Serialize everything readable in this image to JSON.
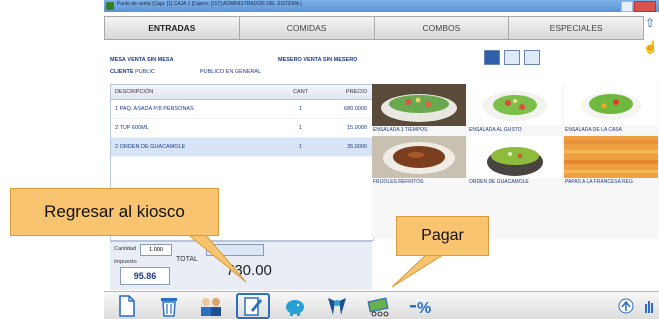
{
  "window": {
    "title": "Punto de venta  (Caja: [1] CAJA 1   [Cajero: [157] ADMINISTRADOR DEL SISTEMA ]"
  },
  "tabs": [
    {
      "label": "ENTRADAS",
      "active": true
    },
    {
      "label": "COMIDAS",
      "active": false
    },
    {
      "label": "COMBOS",
      "active": false
    },
    {
      "label": "ESPECIALES",
      "active": false
    }
  ],
  "order_info": {
    "mesa_label": "MESA",
    "mesa_value": "VENTA SIN MESA",
    "cliente_label": "CLIENTE",
    "cliente_value": "PUBLIC",
    "cliente_name": "PUBLICO EN GENERAL",
    "mesero_label": "MESERO",
    "mesero_value": "VENTA SIN MESERO"
  },
  "order_table": {
    "headers": {
      "desc": "DESCRIPCIÓN",
      "cant": "CANT",
      "price": "PRECIO"
    },
    "rows": [
      {
        "desc": "1  PAQ. ASADA P/8 PERSONAS",
        "cant": "1",
        "price": "680.0000"
      },
      {
        "desc": "2  TUP 600ML",
        "cant": "1",
        "price": "15.0000"
      },
      {
        "desc": "2  ORDEN DE GUACAMOLE",
        "cant": "1",
        "price": "35.0000"
      }
    ]
  },
  "food_items": [
    {
      "label": "ENSALADA 3 TIEMPOS"
    },
    {
      "label": "ENSALADA AL GUSTO"
    },
    {
      "label": "ENSALADA DE LA CASA"
    },
    {
      "label": "FRIJOLES REFRITOS"
    },
    {
      "label": "ORDEN DE GUACAMOLE"
    },
    {
      "label": "PAPAS A LA FRANCESA REG"
    }
  ],
  "totals": {
    "cantidad_label": "Cantidad",
    "cantidad_value": "1.000",
    "impuesto_label": "Impuesto",
    "impuesto_value": "95.86",
    "total_label": "TOTAL",
    "total_value": "730.00"
  },
  "toolbar": {
    "new": "new-document-icon",
    "delete": "trash-icon",
    "customers": "people-icon",
    "kiosk": "edit-kiosk-icon",
    "payment": "piggy-bank-icon",
    "waiters": "waiters-icon",
    "pay": "pay-cash-icon",
    "discount": "percent-discount-icon"
  },
  "callouts": {
    "kiosk": "Regresar al kiosco",
    "pay": "Pagar"
  },
  "colors": {
    "accent": "#2e5fa8",
    "callout": "#f8c470",
    "text_blue": "#1f3b8a"
  }
}
